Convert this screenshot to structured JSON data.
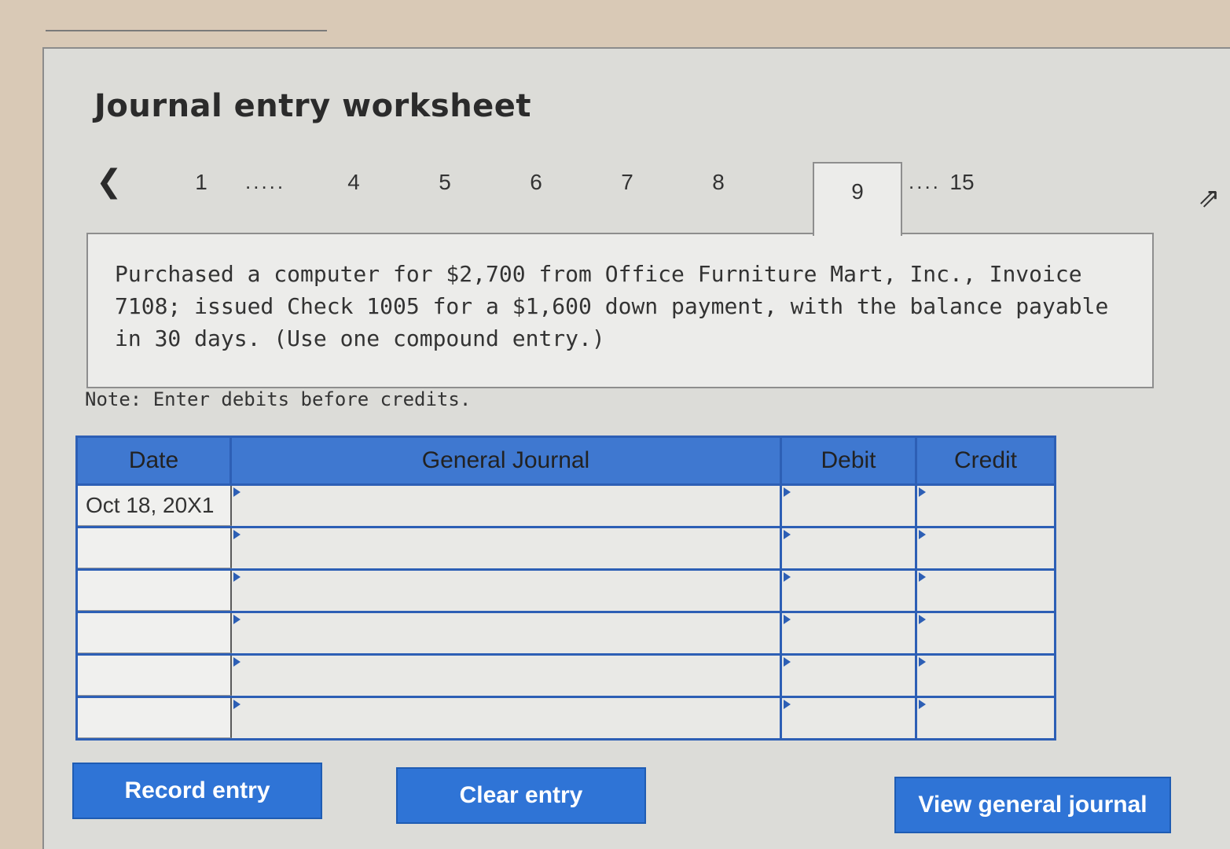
{
  "worksheet": {
    "title": "Journal entry worksheet",
    "nav": {
      "prev_icon": "chevron-left-icon",
      "tabs": [
        "1",
        "4",
        "5",
        "6",
        "7",
        "8",
        "9",
        "15"
      ],
      "dots_short": ".....",
      "dots_long": "....",
      "active_tab": "9"
    },
    "question": "Purchased a computer for $2,700 from Office Furniture Mart, Inc., Invoice 7108; issued Check 1005 for a $1,600 down payment, with the balance payable in 30 days. (Use one compound entry.)",
    "note": "Note: Enter debits before credits."
  },
  "journal": {
    "headers": {
      "date": "Date",
      "general_journal": "General Journal",
      "debit": "Debit",
      "credit": "Credit"
    },
    "rows": [
      {
        "date": "Oct 18, 20X1",
        "account": "",
        "debit": "",
        "credit": ""
      },
      {
        "date": "",
        "account": "",
        "debit": "",
        "credit": ""
      },
      {
        "date": "",
        "account": "",
        "debit": "",
        "credit": ""
      },
      {
        "date": "",
        "account": "",
        "debit": "",
        "credit": ""
      },
      {
        "date": "",
        "account": "",
        "debit": "",
        "credit": ""
      },
      {
        "date": "",
        "account": "",
        "debit": "",
        "credit": ""
      }
    ]
  },
  "buttons": {
    "record": "Record entry",
    "clear": "Clear entry",
    "view": "View general journal"
  },
  "colors": {
    "accent": "#2f74d6",
    "header": "#3f78d0",
    "panel": "#dcdcd8"
  }
}
